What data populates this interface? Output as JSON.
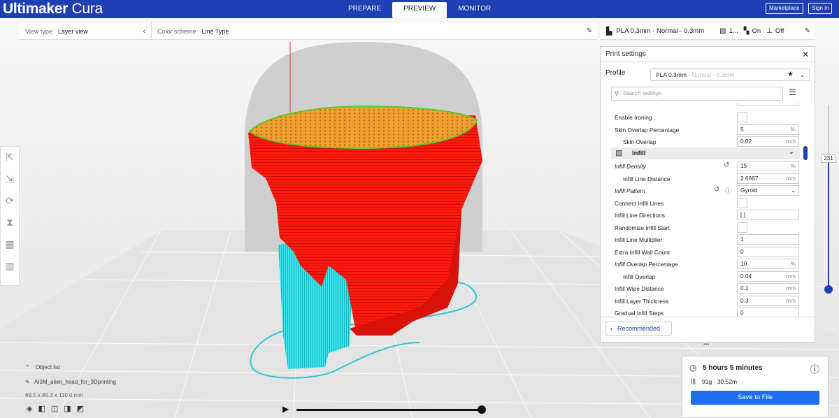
{
  "app": {
    "title_bold": "Ultimaker",
    "title_light": " Cura"
  },
  "stages": [
    "PREPARE",
    "PREVIEW",
    "MONITOR"
  ],
  "top_buttons": {
    "marketplace": "Marketplace",
    "signin": "Sign in"
  },
  "view": {
    "view_type_label": "View type",
    "view_type_value": "Layer view",
    "color_scheme_label": "Color scheme",
    "color_scheme_value": "Line Type"
  },
  "printer": {
    "profile": "PLA 0.3mm - Normal - 0.3mm",
    "infill_short": "1...",
    "support": "On",
    "adhesion": "Off"
  },
  "settings_panel": {
    "title": "Print settings",
    "profile_label": "Profile",
    "profile_value": "PLA 0.3mm",
    "profile_value_suffix": " - Normal - 0.3mm",
    "search_placeholder": "Search settings",
    "rows": [
      {
        "label": "Enable Ironing",
        "type": "check"
      },
      {
        "label": "Skin Overlap Percentage",
        "value": "5",
        "unit": "%"
      },
      {
        "label": "Skin Overlap",
        "value": "0.02",
        "unit": "mm",
        "indent": true
      },
      {
        "label": "Infill",
        "type": "category"
      },
      {
        "label": "Infill Density",
        "value": "15",
        "unit": "%",
        "italic": true,
        "reset": true
      },
      {
        "label": "Infill Line Distance",
        "value": "2.6667",
        "unit": "mm",
        "indent": true
      },
      {
        "label": "Infill Pattern",
        "value": "Gyroid",
        "italic": true,
        "reset": true,
        "dropdown": true
      },
      {
        "label": "Connect Infill Lines",
        "type": "check"
      },
      {
        "label": "Infill Line Directions",
        "value": "[ ]"
      },
      {
        "label": "Randomize Infill Start",
        "type": "check"
      },
      {
        "label": "Infill Line Multiplier",
        "value": "1"
      },
      {
        "label": "Extra Infill Wall Count",
        "value": "0"
      },
      {
        "label": "Infill Overlap Percentage",
        "value": "10",
        "unit": "%",
        "italic": true
      },
      {
        "label": "Infill Overlap",
        "value": "0.04",
        "unit": "mm",
        "indent": true
      },
      {
        "label": "Infill Wipe Distance",
        "value": "0.1",
        "unit": "mm"
      },
      {
        "label": "Infill Layer Thickness",
        "value": "0.3",
        "unit": "mm"
      },
      {
        "label": "Gradual Infill Steps",
        "value": "0"
      }
    ],
    "recommended_label": "Recommended"
  },
  "object_list": {
    "header": "Object list",
    "file": "AI3M_alien_head_for_3Dprinting",
    "dimensions": "69.5 x 89.3 x 110.0 mm"
  },
  "layer": {
    "current": "231"
  },
  "print_info": {
    "time": "5 hours 5 minutes",
    "material": "91g · 30.52m",
    "save_label": "Save to File"
  },
  "colors": {
    "accent": "#1e3fb4",
    "button": "#1e6ef0",
    "model_red": "#ff1a0d",
    "support_cyan": "#39e3ea",
    "infill_orange": "#f0a030"
  }
}
